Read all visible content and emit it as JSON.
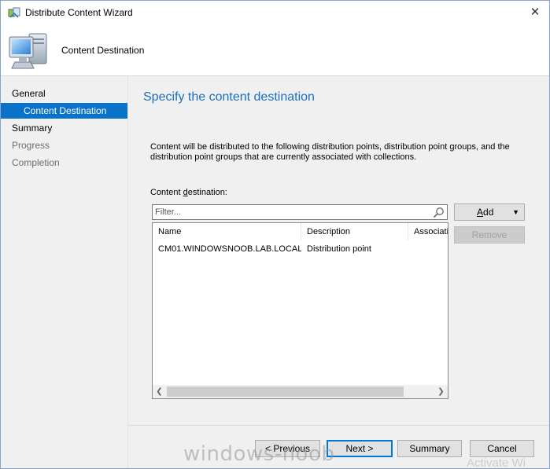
{
  "window": {
    "title": "Distribute Content Wizard",
    "close_glyph": "✕"
  },
  "header": {
    "title": "Content Destination",
    "icon": "computer-icon"
  },
  "nav": {
    "items": [
      {
        "label": "General",
        "state": "normal"
      },
      {
        "label": "Content Destination",
        "state": "selected"
      },
      {
        "label": "Summary",
        "state": "normal"
      },
      {
        "label": "Progress",
        "state": "disabled"
      },
      {
        "label": "Completion",
        "state": "disabled"
      }
    ]
  },
  "main": {
    "title": "Specify the content destination",
    "description": "Content will be distributed to the following distribution points, distribution point groups, and the distribution point groups that are currently associated with collections.",
    "destination_label_prefix": "Content ",
    "destination_label_mnemonic": "d",
    "destination_label_suffix": "estination:",
    "filter": {
      "placeholder": "Filter...",
      "value": ""
    },
    "table": {
      "columns": [
        "Name",
        "Description",
        "Associatio"
      ],
      "rows": [
        {
          "name": "CM01.WINDOWSNOOB.LAB.LOCAL",
          "description": "Distribution point",
          "associations": ""
        }
      ]
    },
    "buttons": {
      "add_mnemonic": "A",
      "add_rest": "dd",
      "remove": "Remove"
    }
  },
  "footer": {
    "previous": "< Previous",
    "next": "Next >",
    "summary": "Summary",
    "cancel": "Cancel"
  },
  "overlays": {
    "watermark": "windows-noob",
    "activate": "Activate Wi"
  },
  "colors": {
    "accent": "#0a73c9",
    "title_blue": "#1a6fc2",
    "panel_bg": "#f0f0f0"
  }
}
